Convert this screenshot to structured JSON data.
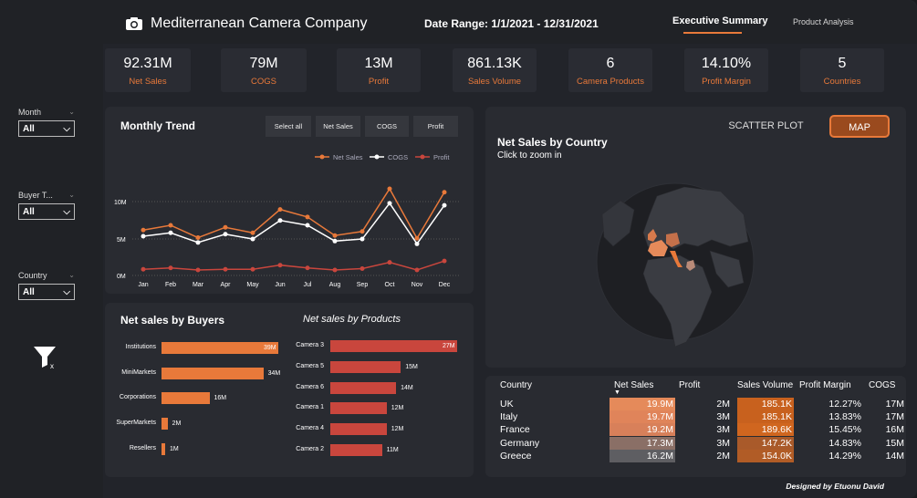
{
  "header": {
    "title": "Mediterranean Camera Company",
    "date_range": "Date Range: 1/1/2021 - 12/31/2021",
    "tabs": [
      {
        "label": "Executive Summary",
        "active": true
      },
      {
        "label": "Product Analysis",
        "active": false
      }
    ]
  },
  "kpis": [
    {
      "value": "92.31M",
      "label": "Net Sales"
    },
    {
      "value": "79M",
      "label": "COGS"
    },
    {
      "value": "13M",
      "label": "Profit"
    },
    {
      "value": "861.13K",
      "label": "Sales Volume"
    },
    {
      "value": "6",
      "label": "Camera Products"
    },
    {
      "value": "14.10%",
      "label": "Profit Margin"
    },
    {
      "value": "5",
      "label": "Countries"
    }
  ],
  "slicers": [
    {
      "label": "Month",
      "value": "All"
    },
    {
      "label": "Buyer T...",
      "value": "All"
    },
    {
      "label": "Country",
      "value": "All"
    }
  ],
  "trend": {
    "title": "Monthly Trend",
    "buttons": [
      "Select all",
      "Net Sales",
      "COGS",
      "Profit"
    ],
    "legend": [
      "Net Sales",
      "COGS",
      "Profit"
    ],
    "y_ticks": [
      "10M",
      "5M",
      "0M"
    ]
  },
  "buyers": {
    "title": "Net sales by Buyers"
  },
  "products": {
    "title": "Net sales by Products"
  },
  "map": {
    "title": "Net Sales by Country",
    "subtitle": "Click to zoom in",
    "buttons": [
      "SCATTER PLOT",
      "MAP"
    ]
  },
  "country_table": {
    "headers": [
      "Country",
      "Net Sales",
      "Profit",
      "Sales Volume",
      "Profit Margin",
      "COGS"
    ],
    "rows": [
      {
        "country": "UK",
        "net_sales": "19.9M",
        "profit": "2M",
        "volume": "185.1K",
        "margin": "12.27%",
        "cogs": "17M"
      },
      {
        "country": "Italy",
        "net_sales": "19.7M",
        "profit": "3M",
        "volume": "185.1K",
        "margin": "13.83%",
        "cogs": "17M"
      },
      {
        "country": "France",
        "net_sales": "19.2M",
        "profit": "3M",
        "volume": "189.6K",
        "margin": "15.45%",
        "cogs": "16M"
      },
      {
        "country": "Germany",
        "net_sales": "17.3M",
        "profit": "3M",
        "volume": "147.2K",
        "margin": "14.83%",
        "cogs": "15M"
      },
      {
        "country": "Greece",
        "net_sales": "16.2M",
        "profit": "2M",
        "volume": "154.0K",
        "margin": "14.29%",
        "cogs": "14M"
      }
    ]
  },
  "footer": "Designed by Etuonu David",
  "colors": {
    "accent": "#e8793a",
    "net_sales": "#e8793a",
    "cogs": "#ffffff",
    "profit": "#c9463d",
    "products_bar": "#c9463d"
  },
  "chart_data": [
    {
      "type": "line",
      "categories": [
        "Jan",
        "Feb",
        "Mar",
        "Apr",
        "May",
        "Jun",
        "Jul",
        "Aug",
        "Sep",
        "Oct",
        "Nov",
        "Dec"
      ],
      "series": [
        {
          "name": "Net Sales",
          "values": [
            6.6,
            7.3,
            5.5,
            7.0,
            6.2,
            9.6,
            8.5,
            5.8,
            6.4,
            12.6,
            5.4,
            12.1
          ]
        },
        {
          "name": "COGS",
          "values": [
            5.7,
            6.2,
            4.8,
            6.0,
            5.3,
            8.0,
            7.3,
            5.0,
            5.3,
            10.5,
            4.6,
            10.2
          ]
        },
        {
          "name": "Profit",
          "values": [
            0.9,
            1.1,
            0.8,
            0.9,
            0.9,
            1.5,
            1.1,
            0.8,
            1.0,
            1.9,
            0.8,
            2.1
          ]
        }
      ],
      "title": "Monthly Trend",
      "ylim": [
        0,
        13
      ]
    },
    {
      "type": "bar",
      "title": "Net sales by Buyers",
      "categories": [
        "Institutions",
        "MiniMarkets",
        "Corporations",
        "SuperMarkets",
        "Resellers"
      ],
      "values": [
        39,
        34,
        16,
        2,
        1
      ],
      "labels": [
        "39M",
        "34M",
        "16M",
        "2M",
        "1M"
      ]
    },
    {
      "type": "bar",
      "title": "Net sales by Products",
      "categories": [
        "Camera 3",
        "Camera 5",
        "Camera 6",
        "Camera 1",
        "Camera 4",
        "Camera 2"
      ],
      "values": [
        27,
        15,
        14,
        12,
        12,
        11
      ],
      "labels": [
        "27M",
        "15M",
        "14M",
        "12M",
        "12M",
        "11M"
      ]
    }
  ]
}
